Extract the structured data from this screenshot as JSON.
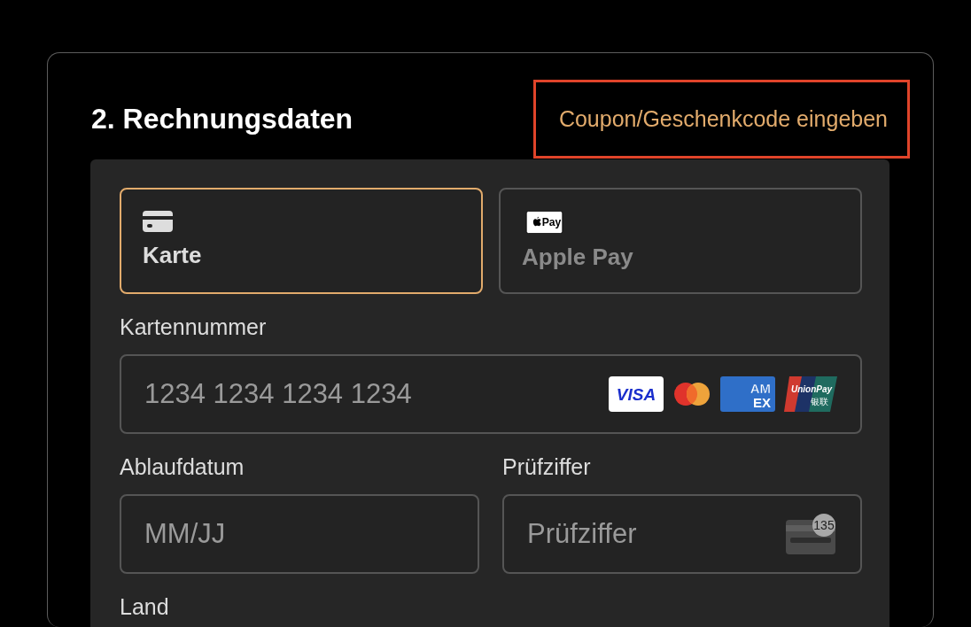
{
  "section": {
    "title": "2. Rechnungsdaten",
    "coupon_link": {
      "label": "Coupon/Geschenkcode eingeben",
      "highlighted": true
    }
  },
  "payment_methods": [
    {
      "kind": "card",
      "label": "Karte",
      "selected": true
    },
    {
      "kind": "apple_pay",
      "label": "Apple Pay",
      "badge": "Pay",
      "selected": false
    }
  ],
  "fields": [
    {
      "kind": "card_number",
      "label": "Kartennummer",
      "placeholder": "1234 1234 1234 1234",
      "brands": [
        {
          "kind": "visa",
          "text": [
            "VISA"
          ]
        },
        {
          "kind": "mastercard"
        },
        {
          "kind": "amex",
          "text": [
            "AM",
            "EX"
          ]
        },
        {
          "kind": "unionpay",
          "text": [
            "UnionPay",
            "银联"
          ]
        }
      ]
    },
    {
      "kind": "expiry",
      "label": "Ablaufdatum",
      "placeholder": "MM/JJ"
    },
    {
      "kind": "cvc",
      "label": "Prüfziffer",
      "placeholder": "Prüfziffer",
      "badge": "135"
    },
    {
      "kind": "country",
      "label": "Land"
    }
  ]
}
